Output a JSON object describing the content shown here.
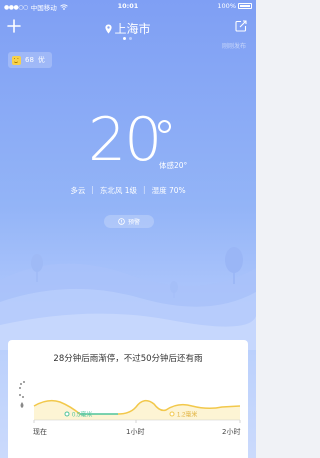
{
  "status_bar": {
    "carrier": "中国移动",
    "time": "10:01",
    "battery": "100%"
  },
  "header": {
    "city": "上海市",
    "caption": "刚刚发布",
    "page_count": 2,
    "active_page": 1
  },
  "aqi": {
    "value": "68",
    "level": "优"
  },
  "weather": {
    "temperature": "20",
    "feels_like": "体感20°",
    "condition": "多云",
    "wind": "东北风 1级",
    "humidity": "湿度 70%",
    "alert_label": "预警"
  },
  "rain_card": {
    "message": "28分钟后雨渐停，不过50分钟后还有雨",
    "label_low": "0.5毫米",
    "label_high": "1.2毫米",
    "x_labels": [
      "现在",
      "1小时",
      "2小时"
    ]
  },
  "colors": {
    "sky_top": "#7f9ff4",
    "sky_bottom": "#cbdafc",
    "rain_green": "#4fc39a",
    "rain_yellow": "#f2c84b"
  },
  "icons": [
    "plus-icon",
    "location-pin-icon",
    "share-icon",
    "wifi-icon",
    "aqi-face-icon",
    "warning-icon",
    "drizzle-icon",
    "raindrop-icon"
  ]
}
